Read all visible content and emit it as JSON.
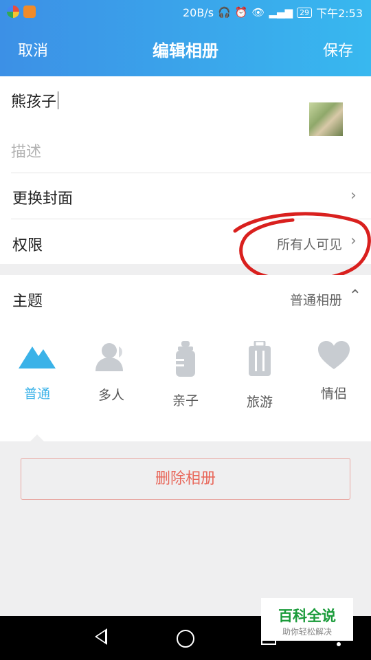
{
  "status_bar": {
    "net_speed": "20B/s",
    "battery": "29",
    "time": "下午2:53"
  },
  "nav": {
    "cancel_label": "取消",
    "title": "编辑相册",
    "save_label": "保存"
  },
  "album": {
    "name": "熊孩子",
    "description_placeholder": "描述",
    "cover_label": "更换封面",
    "permission_label": "权限",
    "permission_value": "所有人可见"
  },
  "theme": {
    "label": "主题",
    "value": "普通相册",
    "items": [
      {
        "label": "普通",
        "icon": "mountain-icon",
        "active": true
      },
      {
        "label": "多人",
        "icon": "people-icon",
        "active": false
      },
      {
        "label": "亲子",
        "icon": "baby-bottle-icon",
        "active": false
      },
      {
        "label": "旅游",
        "icon": "suitcase-icon",
        "active": false
      },
      {
        "label": "情侣",
        "icon": "heart-icon",
        "active": false
      }
    ]
  },
  "delete_label": "删除相册",
  "watermark": {
    "title": "百科全说",
    "subtitle": "助你轻松解决"
  },
  "colors": {
    "header_start": "#3c90e6",
    "header_end": "#38b8ef",
    "active_theme": "#3ab2e8",
    "delete_text": "#e8675a",
    "annotation": "#d9201e"
  }
}
